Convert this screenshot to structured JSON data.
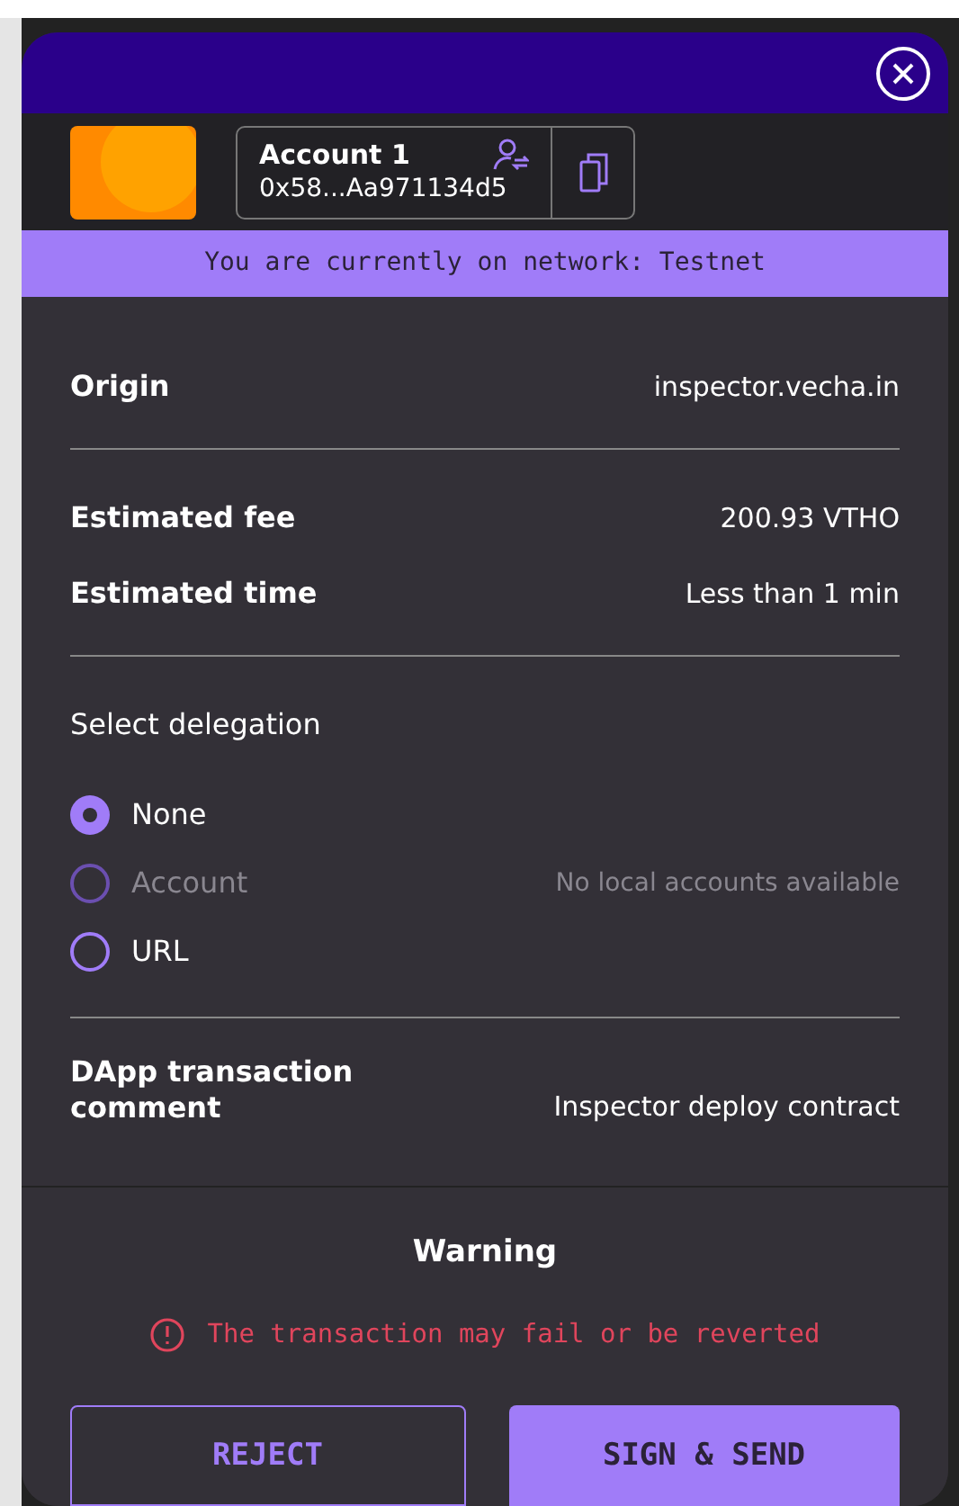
{
  "account": {
    "name": "Account 1",
    "address": "0x58...Aa971134d5"
  },
  "network_banner": "You are currently on network: Testnet",
  "detail_sections": [
    {
      "rows": [
        {
          "label": "Origin",
          "value": "inspector.vecha.in"
        }
      ]
    },
    {
      "rows": [
        {
          "label": "Estimated fee",
          "value": "200.93 VTHO"
        },
        {
          "label": "Estimated time",
          "value": "Less than 1 min"
        }
      ]
    }
  ],
  "delegation": {
    "title": "Select delegation",
    "options": [
      {
        "label": "None",
        "selected": true,
        "disabled": false
      },
      {
        "label": "Account",
        "selected": false,
        "disabled": true,
        "note": "No local accounts available"
      },
      {
        "label": "URL",
        "selected": false,
        "disabled": false
      }
    ]
  },
  "comment": {
    "label": "DApp transaction comment",
    "value": "Inspector deploy contract"
  },
  "warning": {
    "title": "Warning",
    "message": "The transaction may fail or be reverted"
  },
  "buttons": [
    {
      "label": "REJECT",
      "kind": "secondary"
    },
    {
      "label": "SIGN & SEND",
      "kind": "primary"
    }
  ]
}
